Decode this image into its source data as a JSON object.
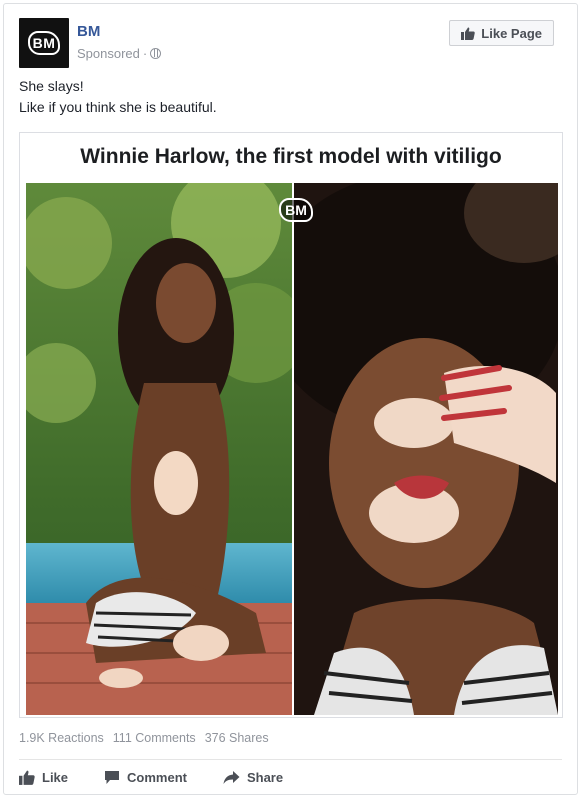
{
  "post": {
    "page_name": "BM",
    "avatar_text": "BM",
    "sponsored": "Sponsored",
    "meta_separator": "·",
    "like_page_label": "Like Page",
    "caption_line1": "She slays!",
    "caption_line2": "Like if you think she is beautiful."
  },
  "media": {
    "title": "Winnie Harlow, the first model with vitiligo",
    "watermark": "BM"
  },
  "stats": {
    "reactions": "1.9K Reactions",
    "comments": "111 Comments",
    "shares": "376 Shares"
  },
  "actions": {
    "like": "Like",
    "comment": "Comment",
    "share": "Share"
  },
  "colors": {
    "link_blue": "#365899",
    "meta_gray": "#90949c",
    "action_gray": "#4b4f56",
    "border": "#dddfe2"
  }
}
